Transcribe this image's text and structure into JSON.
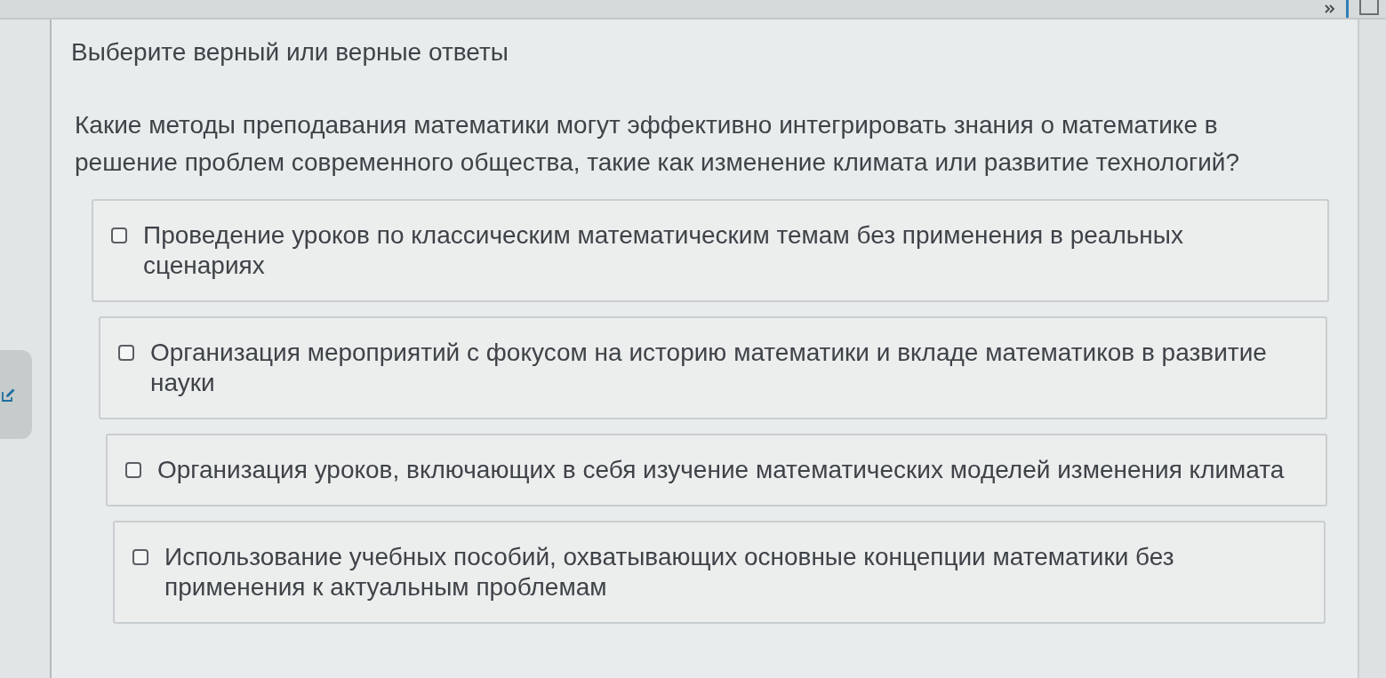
{
  "instruction": "Выберите верный или верные ответы",
  "question": "Какие методы преподавания математики могут эффективно интегрировать знания о математике в решение проблем современного общества, такие как изменение климата или развитие технологий?",
  "options": [
    {
      "text": "Проведение уроков по классическим математическим темам без применения в реальных сценариях",
      "checked": false
    },
    {
      "text": "Организация мероприятий с фокусом на историю математики и вкладе математиков в развитие науки",
      "checked": false
    },
    {
      "text": "Организация уроков, включающих в себя изучение математических моделей изменения климата",
      "checked": false
    },
    {
      "text": "Использование учебных пособий, охватывающих основные концепции математики без применения к актуальным проблемам",
      "checked": false
    }
  ]
}
